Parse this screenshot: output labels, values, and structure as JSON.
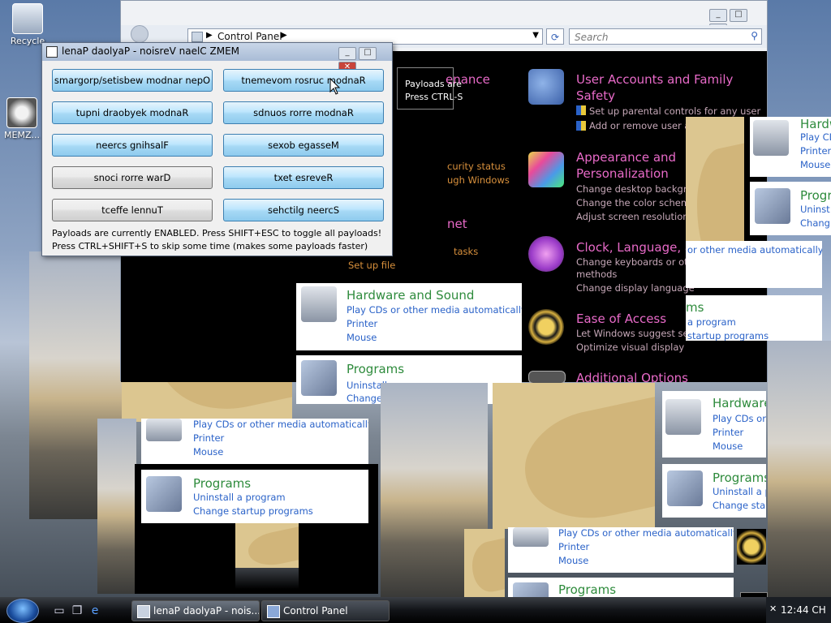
{
  "desktop": {
    "recycle_label": "Recycle",
    "memz_label": "MEMZ..."
  },
  "control_panel": {
    "address": "Control Panel",
    "search_placeholder": "Search",
    "categories": [
      {
        "title_line1": "User Accounts and Family",
        "title_line2": "Safety",
        "links": [
          "Set up parental controls for any user",
          "Add or remove user ac"
        ]
      },
      {
        "title_line1": "Appearance and",
        "title_line2": "Personalization",
        "links": [
          "Change desktop backgrou",
          "Change the color scheme",
          "Adjust screen resolution"
        ]
      },
      {
        "title_line1": "Clock, Language, an",
        "links": [
          "Change keyboards or othe",
          "methods",
          "Change display language"
        ]
      },
      {
        "title_line1": "Ease of Access",
        "links": [
          "Let Windows suggest setti",
          "Optimize visual display"
        ]
      },
      {
        "title_line1": "Additional Options"
      }
    ],
    "left_fragments": {
      "nance": "enance",
      "security": "curity status",
      "windows": "ugh Windows",
      "net": "net",
      "tasks": "tasks",
      "setup_file": "Set up file"
    },
    "notice": [
      "Payloads are",
      "Press CTRL-S"
    ]
  },
  "fragments": {
    "hardware_title": "Hardware and Sound",
    "hardware_title_short": "Hardware",
    "hardware_title_tiny": "Hardw",
    "hardware_links": [
      "Play CDs or other media automatically",
      "Printer",
      "Mouse"
    ],
    "hardware_links_short": [
      "Play CDs or",
      "Printer",
      "Mouse"
    ],
    "hardware_links_tiny": [
      "Play CD",
      "Printer",
      "Mouse"
    ],
    "programs_title": "Programs",
    "programs_title_tiny": "Progr",
    "programs_links": [
      "Uninstall a program",
      "Change startup programs"
    ],
    "programs_links_short": [
      "Uninstall a p",
      "Change start"
    ],
    "programs_links_tiny": [
      "Uninst",
      "Chang"
    ],
    "ms_title": "ms",
    "ms_links": [
      "a program",
      "startup programs"
    ],
    "media_auto": "or other media automatically"
  },
  "memz": {
    "title": "lenaP daolyaP - noisreV naelC ZMEM",
    "buttons": [
      {
        "label": "smargorp/setisbew modnar nepO",
        "enabled": true
      },
      {
        "label": "tnemevom rosruc modnaR",
        "enabled": true
      },
      {
        "label": "tupni draobyek modnaR",
        "enabled": true
      },
      {
        "label": "sdnuos rorre modnaR",
        "enabled": true
      },
      {
        "label": "neercs gnihsalF",
        "enabled": true
      },
      {
        "label": "sexob egasseM",
        "enabled": true
      },
      {
        "label": "snoci rorre warD",
        "enabled": false
      },
      {
        "label": "txet esreveR",
        "enabled": true
      },
      {
        "label": "tceffe lennuT",
        "enabled": false
      },
      {
        "label": "sehctilg neercS",
        "enabled": true
      }
    ],
    "info_line1": "Payloads are currently ENABLED. Press SHIFT+ESC to toggle all payloads!",
    "info_line2": "Press CTRL+SHIFT+S to skip some time (makes some payloads faster)"
  },
  "taskbar": {
    "buttons": [
      "lenaP daolyaP - nois...",
      "Control Panel"
    ],
    "clock": "12:44 CH"
  },
  "colors": {
    "category_title": "#e86ac8",
    "fragment_title": "#2e8b3c",
    "fragment_link": "#2a62c8",
    "payload_enabled": "#a7d9f5",
    "payload_disabled": "#dddddd"
  }
}
